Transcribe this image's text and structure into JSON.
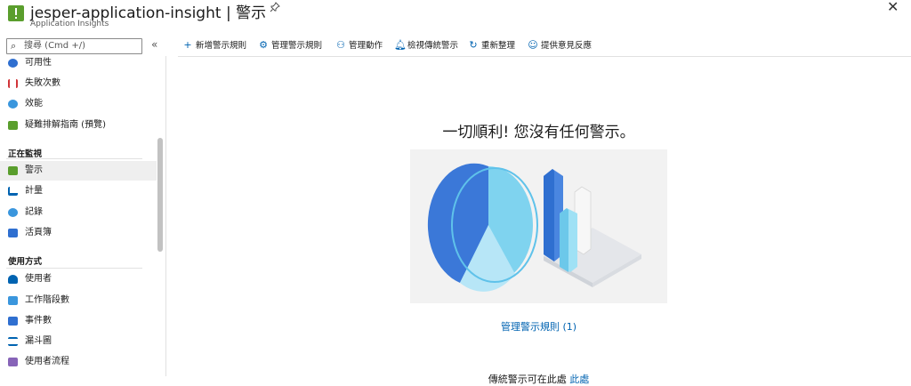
{
  "header": {
    "title": "jesper-application-insight | 警示",
    "subtitle": "Application Insights"
  },
  "sidebar": {
    "search_placeholder": "搜尋 (Cmd +/)",
    "collapse_glyph": "«",
    "items_top": [
      {
        "label": "可用性",
        "icon": "availability-icon",
        "color": "#2f6fd0"
      },
      {
        "label": "失敗次數",
        "icon": "failures-icon",
        "color": "#d13438"
      },
      {
        "label": "效能",
        "icon": "performance-icon",
        "color": "#3a96dd"
      },
      {
        "label": "疑難排解指南 (預覽)",
        "icon": "troubleshoot-icon",
        "color": "#5a9e2d"
      }
    ],
    "section_monitoring": "正在監視",
    "items_monitoring": [
      {
        "label": "警示",
        "icon": "alert-icon",
        "color": "#5a9e2d"
      },
      {
        "label": "計量",
        "icon": "metrics-icon",
        "color": "#0063b1"
      },
      {
        "label": "記錄",
        "icon": "logs-icon",
        "color": "#3a96dd"
      },
      {
        "label": "活頁簿",
        "icon": "workbook-icon",
        "color": "#2f6fd0"
      }
    ],
    "section_usage": "使用方式",
    "items_usage": [
      {
        "label": "使用者",
        "icon": "users-icon",
        "color": "#0063b1"
      },
      {
        "label": "工作階段數",
        "icon": "sessions-icon",
        "color": "#3a96dd"
      },
      {
        "label": "事件數",
        "icon": "events-icon",
        "color": "#2f6fd0"
      },
      {
        "label": "漏斗圖",
        "icon": "funnel-icon",
        "color": "#0063b1"
      },
      {
        "label": "使用者流程",
        "icon": "user-flow-icon",
        "color": "#8764b8"
      }
    ]
  },
  "toolbar": {
    "new_rule": "新增警示規則",
    "manage_rules": "管理警示規則",
    "manage_actions": "管理動作",
    "classic_alerts": "檢視傳統警示",
    "refresh": "重新整理",
    "feedback": "提供意見反應"
  },
  "main": {
    "headline": "一切順利! 您沒有任何警示。",
    "manage_link": "管理警示規則 (1)",
    "bottom_text": "傳統警示可在此處",
    "bottom_link": "此處"
  },
  "colors": {
    "accent": "#0063b1",
    "brand_green": "#5a9e2d"
  }
}
